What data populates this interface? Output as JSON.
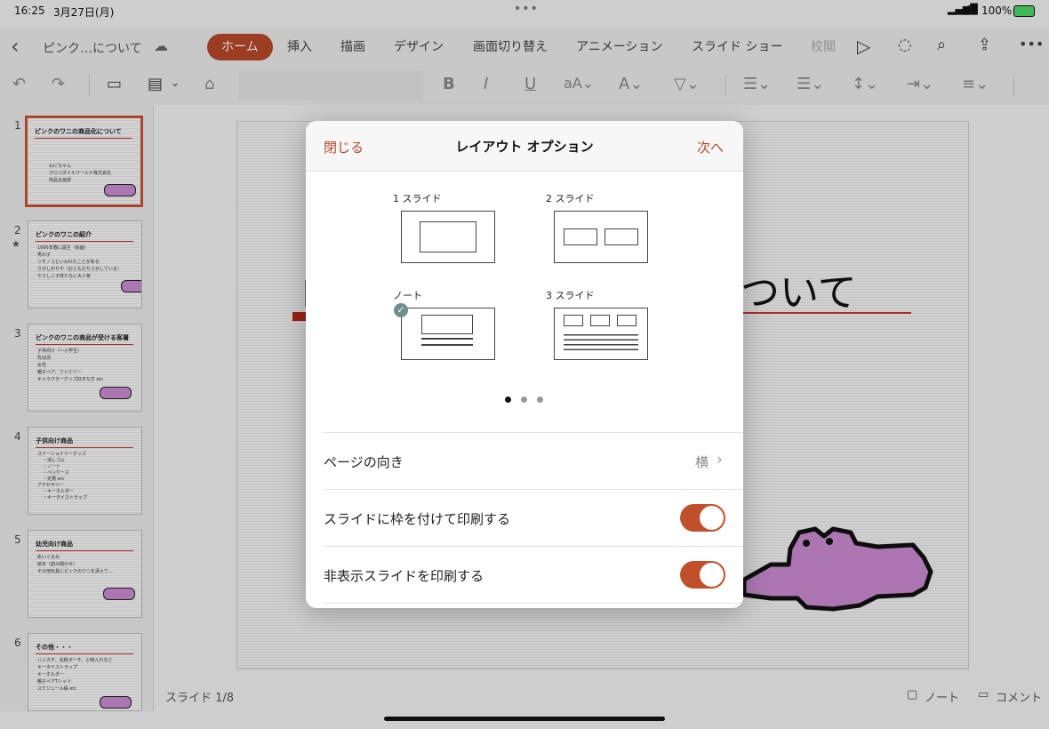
{
  "status": {
    "time": "16:25",
    "date": "3月27日(月)",
    "battery": "100%"
  },
  "doc_title": "ピンク…について",
  "tabs": [
    {
      "label": "ホーム",
      "active": true
    },
    {
      "label": "挿入"
    },
    {
      "label": "描画"
    },
    {
      "label": "デザイン"
    },
    {
      "label": "画面切り替え"
    },
    {
      "label": "アニメーション"
    },
    {
      "label": "スライド ショー"
    },
    {
      "label": "校閲"
    }
  ],
  "thumbnails": [
    {
      "num": "1",
      "title": "ピンクのワニの商品化について",
      "lines": [
        "わにちゃん",
        "クロコダイルワールド株式会社",
        "商品企画部"
      ]
    },
    {
      "num": "2",
      "title": "ピンクのワニの紹介",
      "lines": [
        "1995年春に誕生（仮面）",
        "男の子",
        "ツチノコといわれたことがある",
        "さびしがりや（おともだちさがしている）",
        "やさしく子供たちに大人気"
      ]
    },
    {
      "num": "3",
      "title": "ピンクのワニの商品が受ける客層",
      "lines": [
        "子供向け（〜小学生）",
        "乳幼児",
        "女性",
        "親子ペア、ファミリー",
        "キャラクターグッズ好きな方 etc"
      ]
    },
    {
      "num": "4",
      "title": "子供向け商品",
      "lines": [
        "ステーショナリーグッズ",
        "・消しゴム",
        "・ノート",
        "・ペンケース",
        "・定規 etc",
        "アクセサリー",
        "・キーホルダー",
        "・キータイストラップ"
      ]
    },
    {
      "num": "5",
      "title": "幼児向け商品",
      "lines": [
        "ぬいぐるみ",
        "絵本（読み聞かせ）",
        "その他玩具にピンクのワニを添えて…"
      ]
    },
    {
      "num": "6",
      "title": "その他・・・",
      "lines": [
        "ハンカチ、化粧ポーチ、小物入れなど",
        "キータイストラップ",
        "キーホルダー",
        "親子ペアTシャツ",
        "スケジュール帳 etc"
      ]
    }
  ],
  "slide_title_fragment": "ついて",
  "slide_title_left": "ピ",
  "footer": {
    "slide_counter": "スライド 1/8",
    "notes": "ノート",
    "comments": "コメント"
  },
  "dialog": {
    "close": "閉じる",
    "title": "レイアウト オプション",
    "next": "次へ",
    "options": [
      {
        "label": "1 スライド",
        "selected": false
      },
      {
        "label": "2 スライド",
        "selected": false
      },
      {
        "label": "ノート",
        "selected": true
      },
      {
        "label": "3 スライド",
        "selected": false
      }
    ],
    "page_index": 0,
    "page_count": 3,
    "rows": [
      {
        "label": "ページの向き",
        "value": "横",
        "type": "disclosure"
      },
      {
        "label": "スライドに枠を付けて印刷する",
        "type": "toggle",
        "on": true
      },
      {
        "label": "非表示スライドを印刷する",
        "type": "toggle",
        "on": true
      }
    ]
  },
  "colors": {
    "accent": "#b7472a",
    "toggle_on": "#c24f2c",
    "croc": "#c98bd0"
  }
}
